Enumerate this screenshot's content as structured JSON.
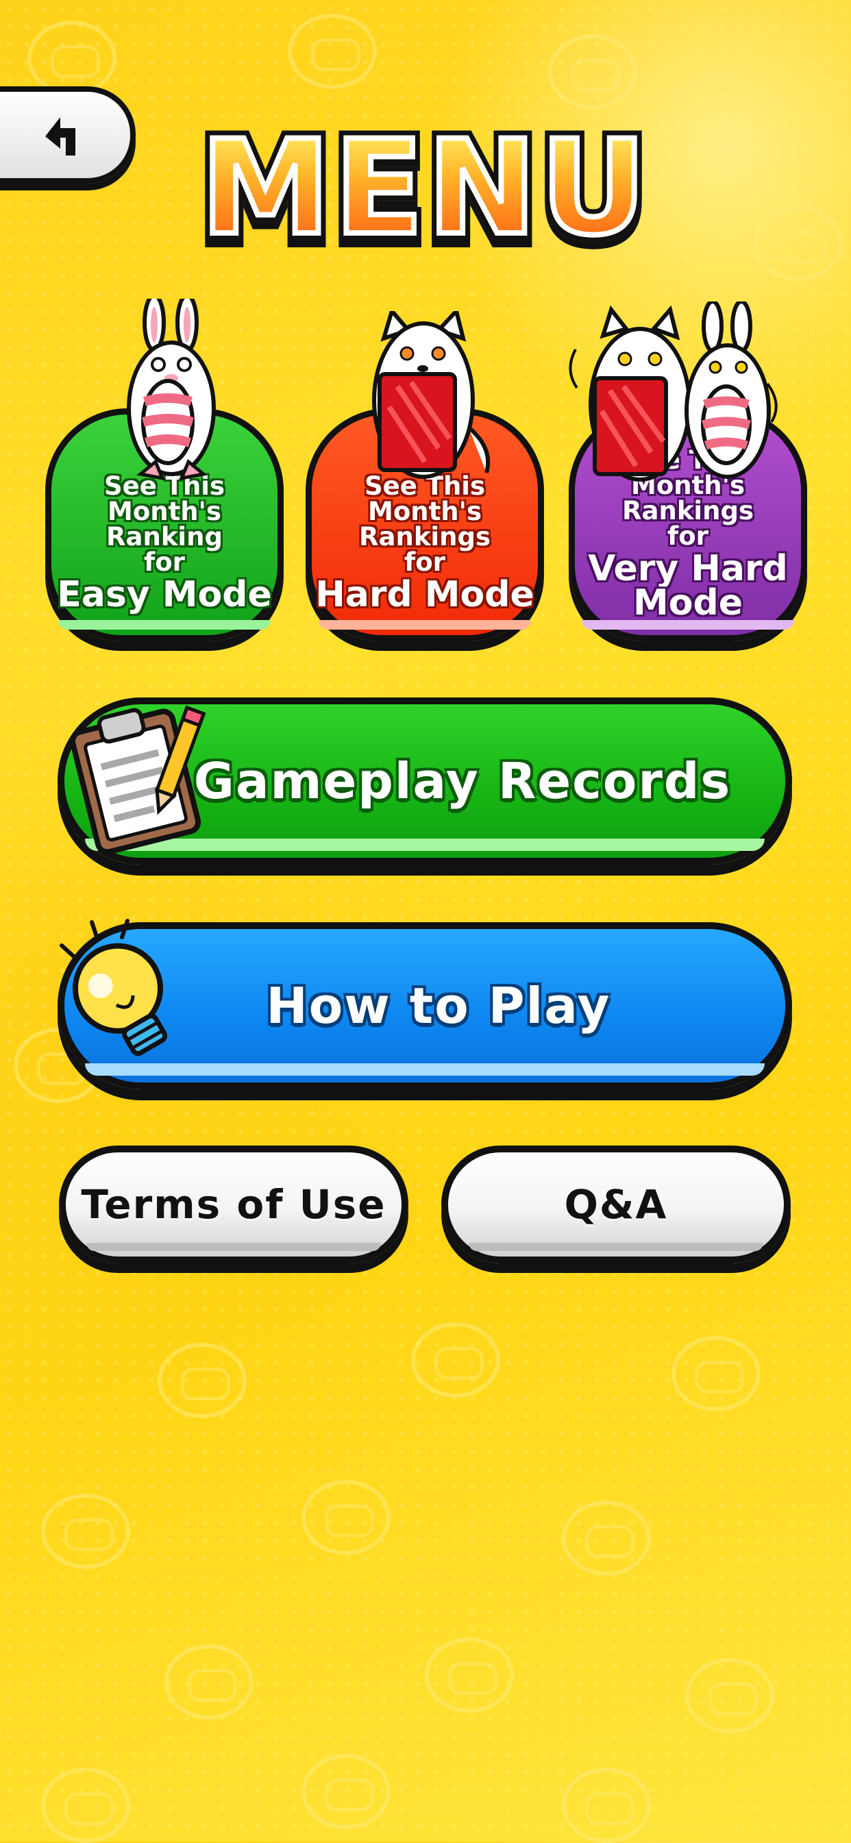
{
  "header": {
    "title": "MENU",
    "back_icon": "return-arrow-icon"
  },
  "rankings": [
    {
      "line1": "See This",
      "line2": "Month's Ranking",
      "line3": "for",
      "mode_line1": "Easy Mode",
      "mode_line2": "",
      "color": "#1bb41f"
    },
    {
      "line1": "See This",
      "line2": "Month's Rankings",
      "line3": "for",
      "mode_line1": "Hard Mode",
      "mode_line2": "",
      "color": "#f83a10"
    },
    {
      "line1": "See This",
      "line2": "Month's Rankings",
      "line3": "for",
      "mode_line1": "Very Hard",
      "mode_line2": "Mode",
      "color": "#9a3cba"
    }
  ],
  "buttons": {
    "records_label": "Gameplay Records",
    "records_icon": "clipboard-icon",
    "records_color": "#16b414",
    "howto_label": "How to Play",
    "howto_icon": "lightbulb-icon",
    "howto_color": "#0d86f0",
    "terms_label": "Terms of Use",
    "qa_label": "Q&A"
  }
}
